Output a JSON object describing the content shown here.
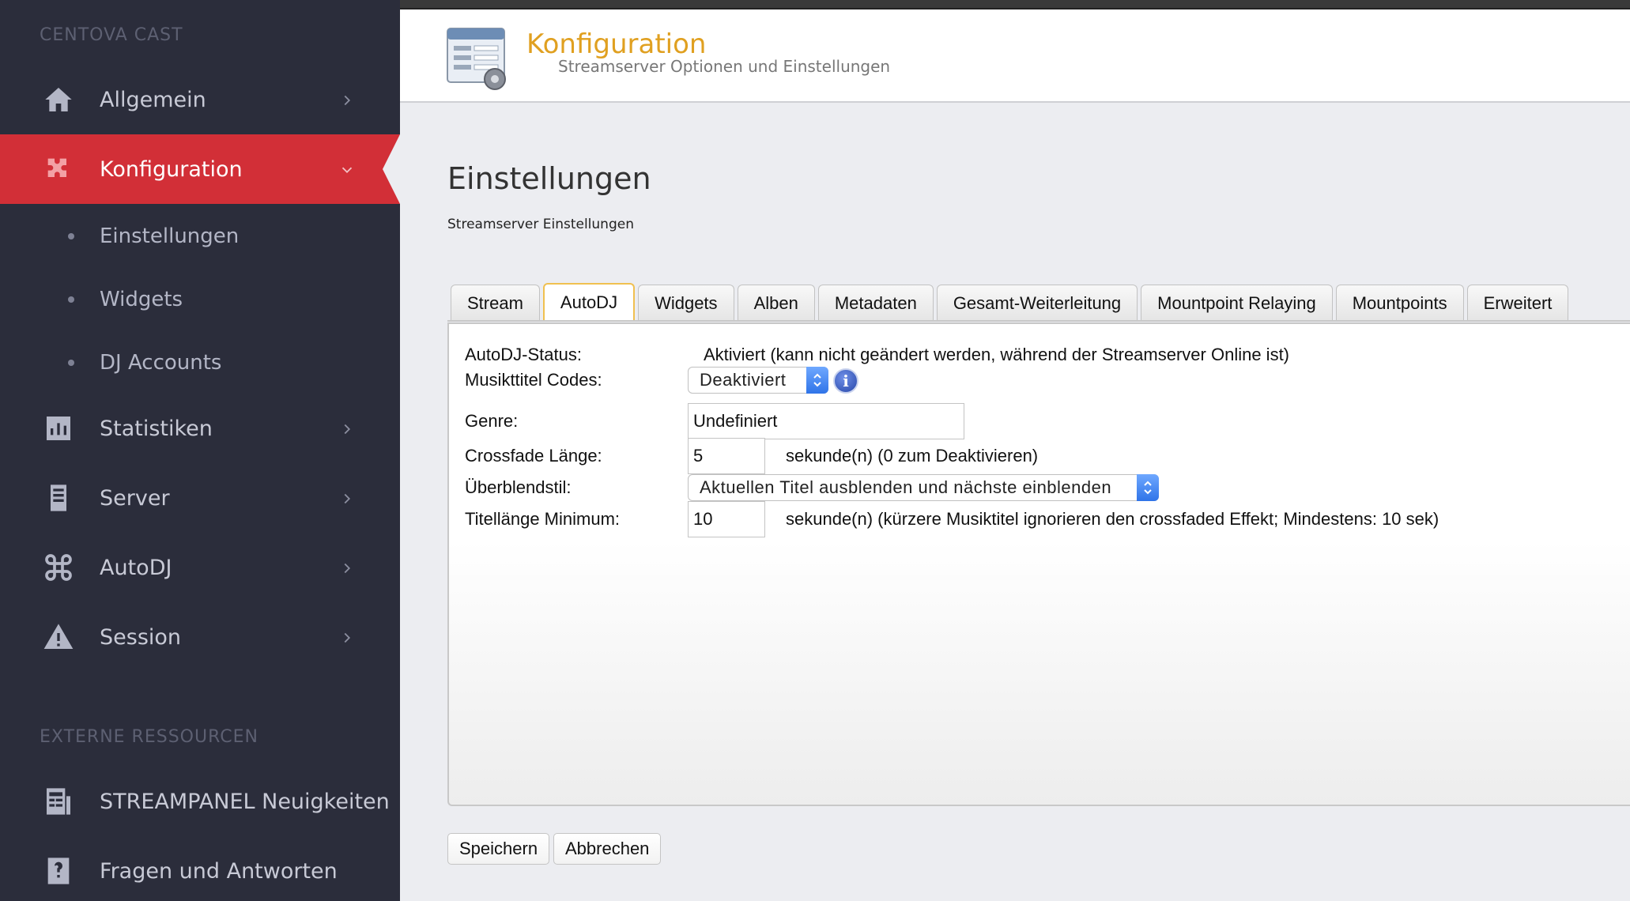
{
  "sidebar": {
    "brand": "CENTOVA CAST",
    "items": [
      {
        "label": "Allgemein",
        "icon": "home-icon"
      },
      {
        "label": "Konfiguration",
        "icon": "puzzle-icon"
      },
      {
        "label": "Statistiken",
        "icon": "bar-chart-icon"
      },
      {
        "label": "Server",
        "icon": "server-icon"
      },
      {
        "label": "AutoDJ",
        "icon": "command-icon"
      },
      {
        "label": "Session",
        "icon": "warning-icon"
      }
    ],
    "subitems": [
      "Einstellungen",
      "Widgets",
      "DJ Accounts"
    ],
    "external_label": "EXTERNE RESSOURCEN",
    "external": [
      {
        "label": "STREAMPANEL Neuigkeiten",
        "icon": "newspaper-icon"
      },
      {
        "label": "Fragen und Antworten",
        "icon": "help-icon"
      }
    ],
    "active_color": "#d22f37"
  },
  "header": {
    "title": "Konfiguration",
    "subtitle": "Streamserver Optionen und Einstellungen"
  },
  "page": {
    "title": "Einstellungen",
    "subtitle": "Streamserver Einstellungen"
  },
  "tabs": [
    "Stream",
    "AutoDJ",
    "Widgets",
    "Alben",
    "Metadaten",
    "Gesamt-Weiterleitung",
    "Mountpoint Relaying",
    "Mountpoints",
    "Erweitert"
  ],
  "active_tab": "AutoDJ",
  "form": {
    "status_label": "AutoDJ-Status:",
    "status_value": "Aktiviert (kann nicht geändert werden, während der Streamserver Online ist)",
    "codes_label": "Musikttitel Codes:",
    "codes_value": "Deaktiviert",
    "genre_label": "Genre:",
    "genre_value": "Undefiniert",
    "crossfade_label": "Crossfade Länge:",
    "crossfade_value": "5",
    "crossfade_hint": "sekunde(n) (0 zum Deaktivieren)",
    "style_label": "Überblendstil:",
    "style_value": "Aktuellen Titel ausblenden und nächste einblenden",
    "minlen_label": "Titellänge Minimum:",
    "minlen_value": "10",
    "minlen_hint": "sekunde(n) (kürzere Musiktitel ignorieren den crossfaded Effekt; Mindestens: 10 sek)"
  },
  "buttons": {
    "save": "Speichern",
    "cancel": "Abbrechen"
  }
}
